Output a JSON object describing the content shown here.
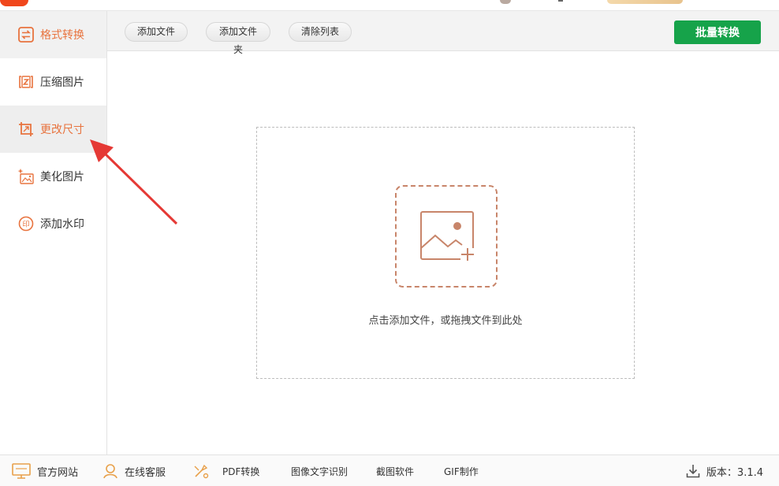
{
  "sidebar": {
    "items": [
      {
        "label": "格式转换",
        "icon": "swap-arrows-icon"
      },
      {
        "label": "压缩图片",
        "icon": "compress-icon"
      },
      {
        "label": "更改尺寸",
        "icon": "crop-resize-icon"
      },
      {
        "label": "美化图片",
        "icon": "beautify-icon"
      },
      {
        "label": "添加水印",
        "icon": "watermark-stamp-icon"
      }
    ]
  },
  "toolbar": {
    "add_file": "添加文件",
    "add_folder": "添加文件夹",
    "clear_list": "清除列表",
    "batch_convert": "批量转换"
  },
  "drop_zone": {
    "hint": "点击添加文件，或拖拽文件到此处",
    "icon": "image-add-icon"
  },
  "footer": {
    "website": "官方网站",
    "support": "在线客服",
    "links": [
      "PDF转换",
      "图像文字识别",
      "截图软件",
      "GIF制作"
    ],
    "version": "版本：3.1.4"
  },
  "colors": {
    "accent": "#e8733e",
    "primary_button": "#16a34a",
    "annotation": "#e53935",
    "dropzone_icon": "#c8856a"
  }
}
